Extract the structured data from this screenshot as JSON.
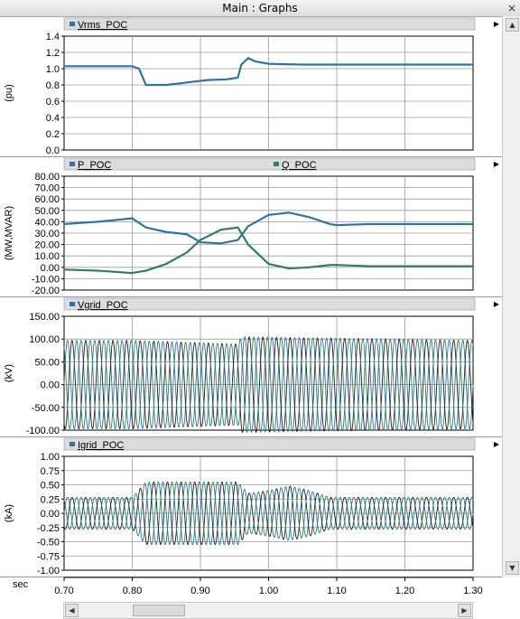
{
  "window": {
    "title": "Main : Graphs",
    "close_icon": "close-icon"
  },
  "x_axis": {
    "label": "sec",
    "min": 0.7,
    "max": 1.3,
    "ticks": [
      "0.70",
      "0.80",
      "0.90",
      "1.00",
      "1.10",
      "1.20",
      "1.30"
    ]
  },
  "colors": {
    "blue": "#2d73a8",
    "green": "#2c7f63",
    "axis": "#000000",
    "grid": "#9a9a9a",
    "header": "#dcdcdc"
  },
  "chart_data": [
    {
      "type": "line",
      "id": "vrms",
      "ylabel": "(pu)",
      "ylim": [
        0,
        1.4
      ],
      "yticks": [
        "0.0",
        "0.2",
        "0.4",
        "0.6",
        "0.8",
        "1.0",
        "1.2",
        "1.4"
      ],
      "series": [
        {
          "name": "Vrms_POC",
          "color": "#2d73a8",
          "x": [
            0.7,
            0.8,
            0.81,
            0.82,
            0.85,
            0.88,
            0.91,
            0.94,
            0.955,
            0.96,
            0.97,
            0.98,
            1.0,
            1.05,
            1.1,
            1.2,
            1.3
          ],
          "y": [
            1.03,
            1.03,
            1.0,
            0.8,
            0.8,
            0.83,
            0.86,
            0.87,
            0.89,
            1.05,
            1.13,
            1.09,
            1.06,
            1.05,
            1.05,
            1.05,
            1.05
          ]
        }
      ]
    },
    {
      "type": "line",
      "id": "pq",
      "ylabel": "(MW,MVAR)",
      "ylim": [
        -20,
        80
      ],
      "yticks": [
        "-20.00",
        "-10.00",
        "0.00",
        "10.00",
        "20.00",
        "30.00",
        "40.00",
        "50.00",
        "60.00",
        "70.00",
        "80.00"
      ],
      "series": [
        {
          "name": "P_POC",
          "color": "#2d73a8",
          "x": [
            0.7,
            0.75,
            0.8,
            0.82,
            0.85,
            0.88,
            0.9,
            0.93,
            0.955,
            0.97,
            1.0,
            1.03,
            1.06,
            1.09,
            1.1,
            1.15,
            1.2,
            1.3
          ],
          "y": [
            38,
            40,
            43,
            35,
            31,
            29,
            22,
            21,
            24,
            36,
            46,
            48,
            44,
            38,
            37,
            38,
            38,
            38
          ]
        },
        {
          "name": "Q_POC",
          "color": "#2c7f63",
          "x": [
            0.7,
            0.75,
            0.8,
            0.82,
            0.85,
            0.88,
            0.9,
            0.93,
            0.955,
            0.97,
            1.0,
            1.03,
            1.06,
            1.09,
            1.1,
            1.15,
            1.2,
            1.3
          ],
          "y": [
            -2,
            -3,
            -5,
            -3,
            3,
            13,
            24,
            33,
            35,
            20,
            3,
            -1,
            0,
            2,
            2,
            1,
            1,
            1
          ]
        }
      ]
    },
    {
      "type": "line",
      "id": "vgrid",
      "ylabel": "(kV)",
      "ylim": [
        -100,
        150
      ],
      "yticks": [
        "-100.00",
        "-50.00",
        "0.00",
        "50.00",
        "100.00",
        "150.00"
      ],
      "series": [
        {
          "name": "Vgrid_POC",
          "color": "#2d73a8",
          "waveform": "three-phase",
          "frequency_hz": 50,
          "x": [
            0.7,
            0.8,
            0.955,
            0.96,
            1.3
          ],
          "amplitude": [
            97,
            97,
            89,
            105,
            97
          ]
        }
      ]
    },
    {
      "type": "line",
      "id": "igrid",
      "ylabel": "(kA)",
      "ylim": [
        -1.0,
        1.0
      ],
      "yticks": [
        "-1.00",
        "-0.75",
        "-0.50",
        "-0.25",
        "0.00",
        "0.25",
        "0.50",
        "0.75",
        "1.00"
      ],
      "series": [
        {
          "name": "Igrid_POC",
          "color": "#2d73a8",
          "waveform": "three-phase",
          "frequency_hz": 50,
          "x": [
            0.7,
            0.8,
            0.82,
            0.955,
            0.97,
            1.0,
            1.03,
            1.06,
            1.09,
            1.3
          ],
          "amplitude": [
            0.28,
            0.28,
            0.55,
            0.55,
            0.35,
            0.4,
            0.48,
            0.4,
            0.28,
            0.28
          ]
        }
      ]
    }
  ]
}
